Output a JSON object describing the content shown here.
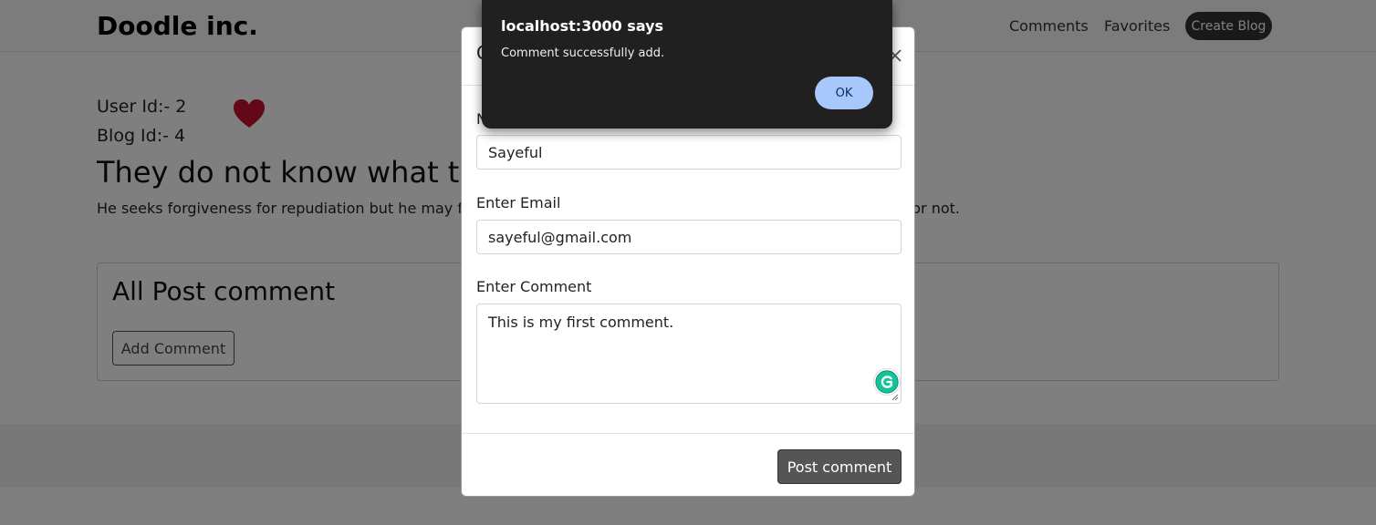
{
  "navbar": {
    "brand": "Doodle inc.",
    "links": [
      "Comments",
      "Favorites"
    ],
    "create_button": "Create Blog"
  },
  "blog": {
    "user_id": "User Id:- 2",
    "blog_id": "Blog Id:- 4",
    "title_visible": "They do not know what th",
    "body_left_visible": "He seeks forgiveness for repudiation but he may flee",
    "body_right_visible": "d or not.",
    "heart_color": "#c8102e"
  },
  "comments_card": {
    "title": "All Post comment",
    "add_button": "Add Comment"
  },
  "modal": {
    "title_visible": "C",
    "name_label_visible": "N",
    "name_value": "Sayeful",
    "email_label": "Enter Email",
    "email_value": "sayeful@gmail.com",
    "comment_label": "Enter Comment",
    "comment_value": "This is my first comment.",
    "submit_button": "Post comment"
  },
  "alert": {
    "title": "localhost:3000 says",
    "message": "Comment successfully add.",
    "ok_button": "OK"
  }
}
